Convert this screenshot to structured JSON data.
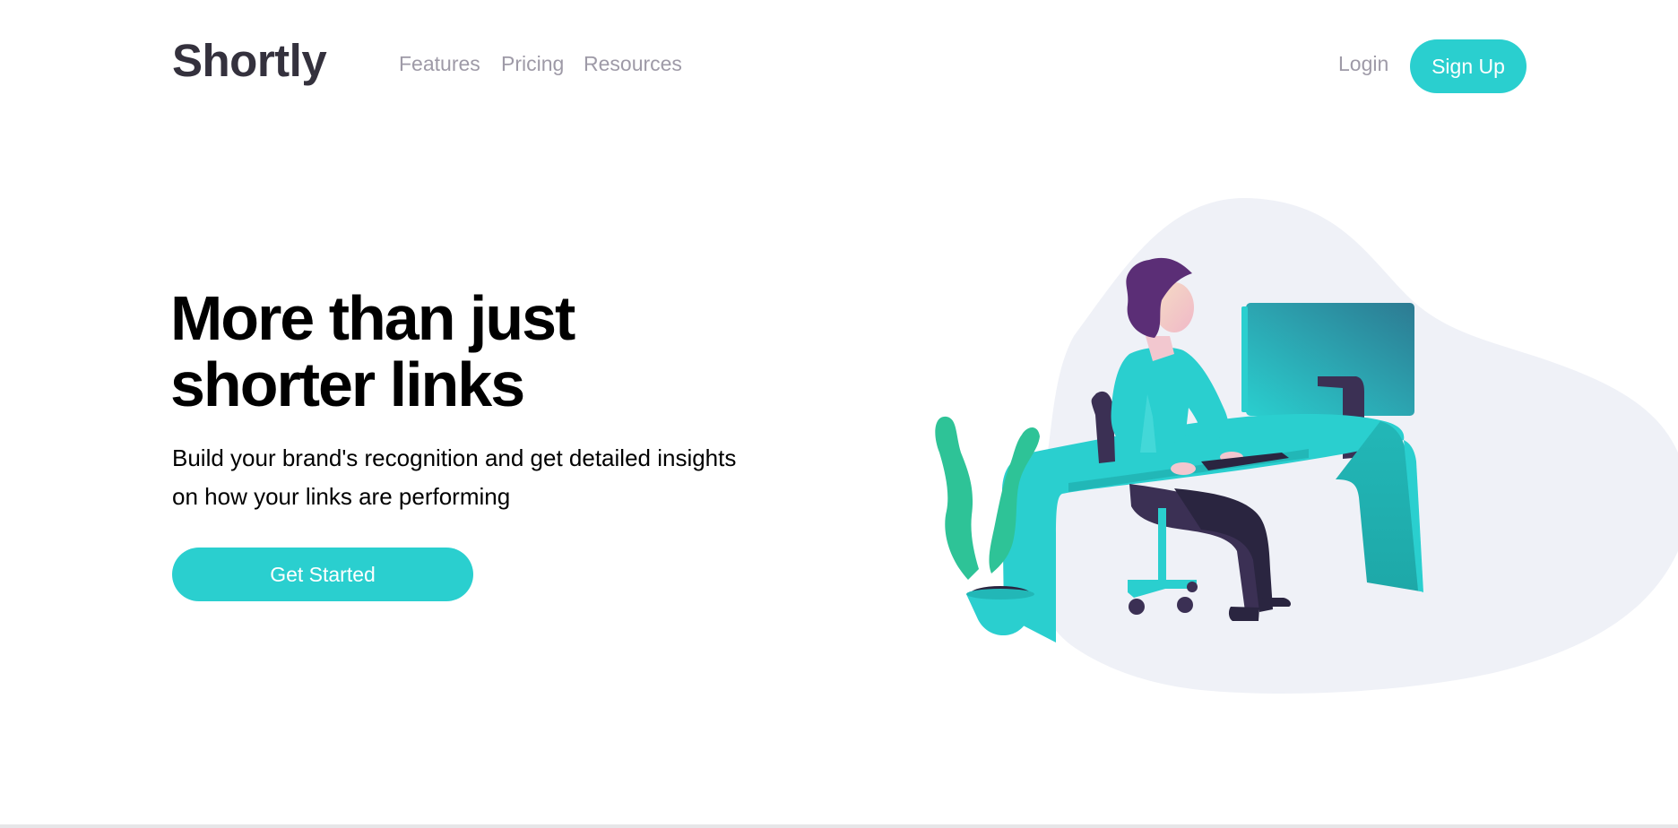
{
  "header": {
    "logo": "Shortly",
    "nav": {
      "features": "Features",
      "pricing": "Pricing",
      "resources": "Resources"
    },
    "login": "Login",
    "signup": "Sign Up"
  },
  "hero": {
    "title_line1": "More than just",
    "title_line2": "shorter links",
    "text_line1": "Build your brand's recognition and get detailed insights",
    "text_line2": "on how your links are performing",
    "cta": "Get Started"
  },
  "colors": {
    "accent": "#2acfcf",
    "logo": "#34313d",
    "nav_text": "#9e9aa7",
    "blob": "#eff1f7"
  }
}
